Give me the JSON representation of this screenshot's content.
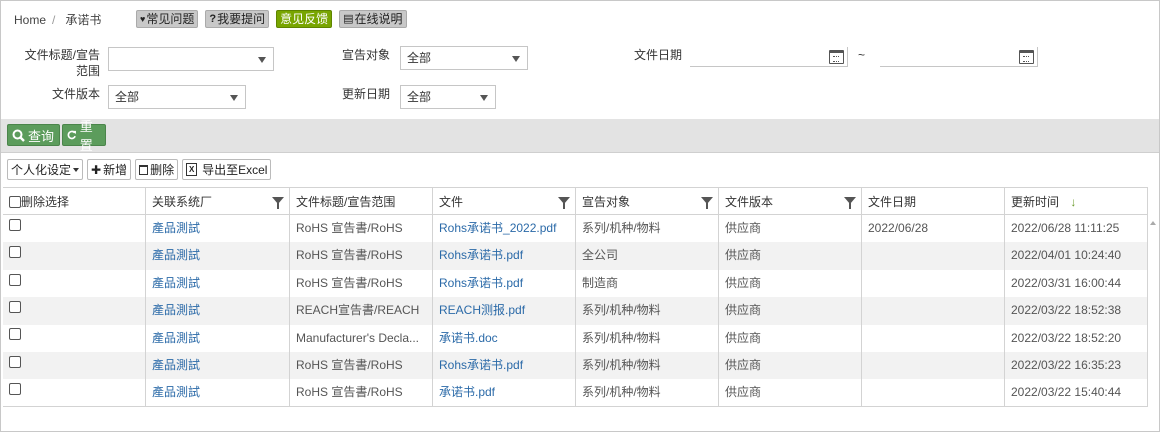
{
  "breadcrumb": {
    "home": "Home",
    "separator": "/",
    "current": "承诺书"
  },
  "top_buttons": [
    {
      "icon": "map-marker-icon",
      "glyph": "♥",
      "label": "常见问题"
    },
    {
      "icon": "question-icon",
      "glyph": "?",
      "label": "我要提问"
    },
    {
      "icon": "",
      "glyph": "",
      "label": "意见反馈"
    },
    {
      "icon": "book-icon",
      "glyph": "▤",
      "label": "在线说明"
    }
  ],
  "filters": {
    "title_label": "文件标题/宣告范围",
    "title_value": "",
    "target_label": "宣告对象",
    "target_value": "全部",
    "date_label": "文件日期",
    "date_sep": "~",
    "date_from": "",
    "date_to": "",
    "version_label": "文件版本",
    "version_value": "全部",
    "update_label": "更新日期",
    "update_value": "全部"
  },
  "actions": {
    "query_label": "查询",
    "reset_label": "重置"
  },
  "toolbar": {
    "personalize_label": "个人化设定",
    "add_label": "新增",
    "delete_label": "删除",
    "export_label": "导出至Excel"
  },
  "table": {
    "columns": [
      "删除选择",
      "关联系统厂",
      "文件标题/宣告范围",
      "文件",
      "宣告对象",
      "文件版本",
      "文件日期",
      "更新时间"
    ],
    "sort_indicator": "↓",
    "rows": [
      {
        "vendor": "產品測試",
        "title": "RoHS 宣告書/RoHS",
        "file": "Rohs承诺书_2022.pdf",
        "target": "系列/机种/物料",
        "version": "供应商",
        "date": "2022/06/28",
        "updated": "2022/06/28 11:11:25"
      },
      {
        "vendor": "產品測試",
        "title": "RoHS 宣告書/RoHS",
        "file": "Rohs承诺书.pdf",
        "target": "全公司",
        "version": "供应商",
        "date": "",
        "updated": "2022/04/01 10:24:40"
      },
      {
        "vendor": "產品測試",
        "title": "RoHS 宣告書/RoHS",
        "file": "Rohs承诺书.pdf",
        "target": "制造商",
        "version": "供应商",
        "date": "",
        "updated": "2022/03/31 16:00:44"
      },
      {
        "vendor": "產品測試",
        "title": "REACH宣告書/REACH",
        "file": "REACH测报.pdf",
        "target": "系列/机种/物料",
        "version": "供应商",
        "date": "",
        "updated": "2022/03/22 18:52:38"
      },
      {
        "vendor": "產品測試",
        "title": "Manufacturer's Decla...",
        "file": "承诺书.doc",
        "target": "系列/机种/物料",
        "version": "供应商",
        "date": "",
        "updated": "2022/03/22 18:52:20"
      },
      {
        "vendor": "產品測試",
        "title": "RoHS 宣告書/RoHS",
        "file": "Rohs承诺书.pdf",
        "target": "系列/机种/物料",
        "version": "供应商",
        "date": "",
        "updated": "2022/03/22 16:35:23"
      },
      {
        "vendor": "產品測試",
        "title": "RoHS 宣告書/RoHS",
        "file": "承诺书.pdf",
        "target": "系列/机种/物料",
        "version": "供应商",
        "date": "",
        "updated": "2022/03/22 15:40:44"
      }
    ]
  },
  "colors": {
    "green_button": "#5c9c5c",
    "feedback_button": "#78a500",
    "link": "#2b6aa8",
    "sort_arrow": "#6a9a2a"
  }
}
